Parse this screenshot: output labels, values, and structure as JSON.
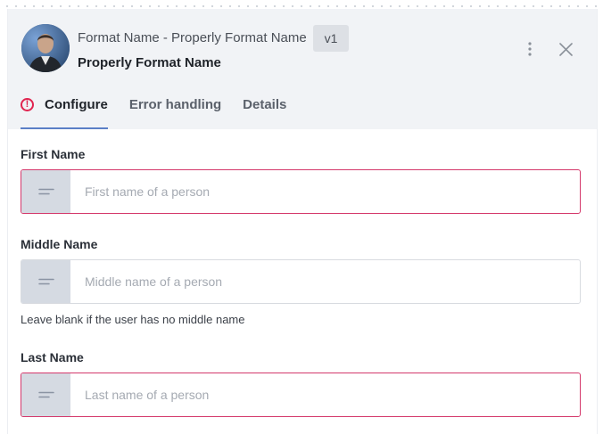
{
  "header": {
    "title_line1": "Format Name - Properly Format Name",
    "version": "v1",
    "title_line2": "Properly Format Name"
  },
  "tabs": [
    {
      "label": "Configure",
      "active": true,
      "has_error": true
    },
    {
      "label": "Error handling",
      "active": false
    },
    {
      "label": "Details",
      "active": false
    }
  ],
  "fields": {
    "first_name": {
      "label": "First Name",
      "value": "",
      "placeholder": "First name of a person",
      "invalid": true
    },
    "middle_name": {
      "label": "Middle Name",
      "value": "",
      "placeholder": "Middle name of a person",
      "help": "Leave blank if the user has no middle name",
      "invalid": false
    },
    "last_name": {
      "label": "Last Name",
      "value": "",
      "placeholder": "Last name of a person",
      "invalid": true
    }
  },
  "icons": {
    "avatar": "avatar-image",
    "more": "more-vertical-icon",
    "close": "close-icon",
    "error": "error-circle-icon",
    "field_prefix": "text-lines-icon"
  },
  "colors": {
    "accent": "#5b7fc7",
    "error": "#e0244f",
    "invalid_border": "#d4386b",
    "header_bg": "#f1f3f6",
    "prefix_bg": "#d5dae2"
  }
}
